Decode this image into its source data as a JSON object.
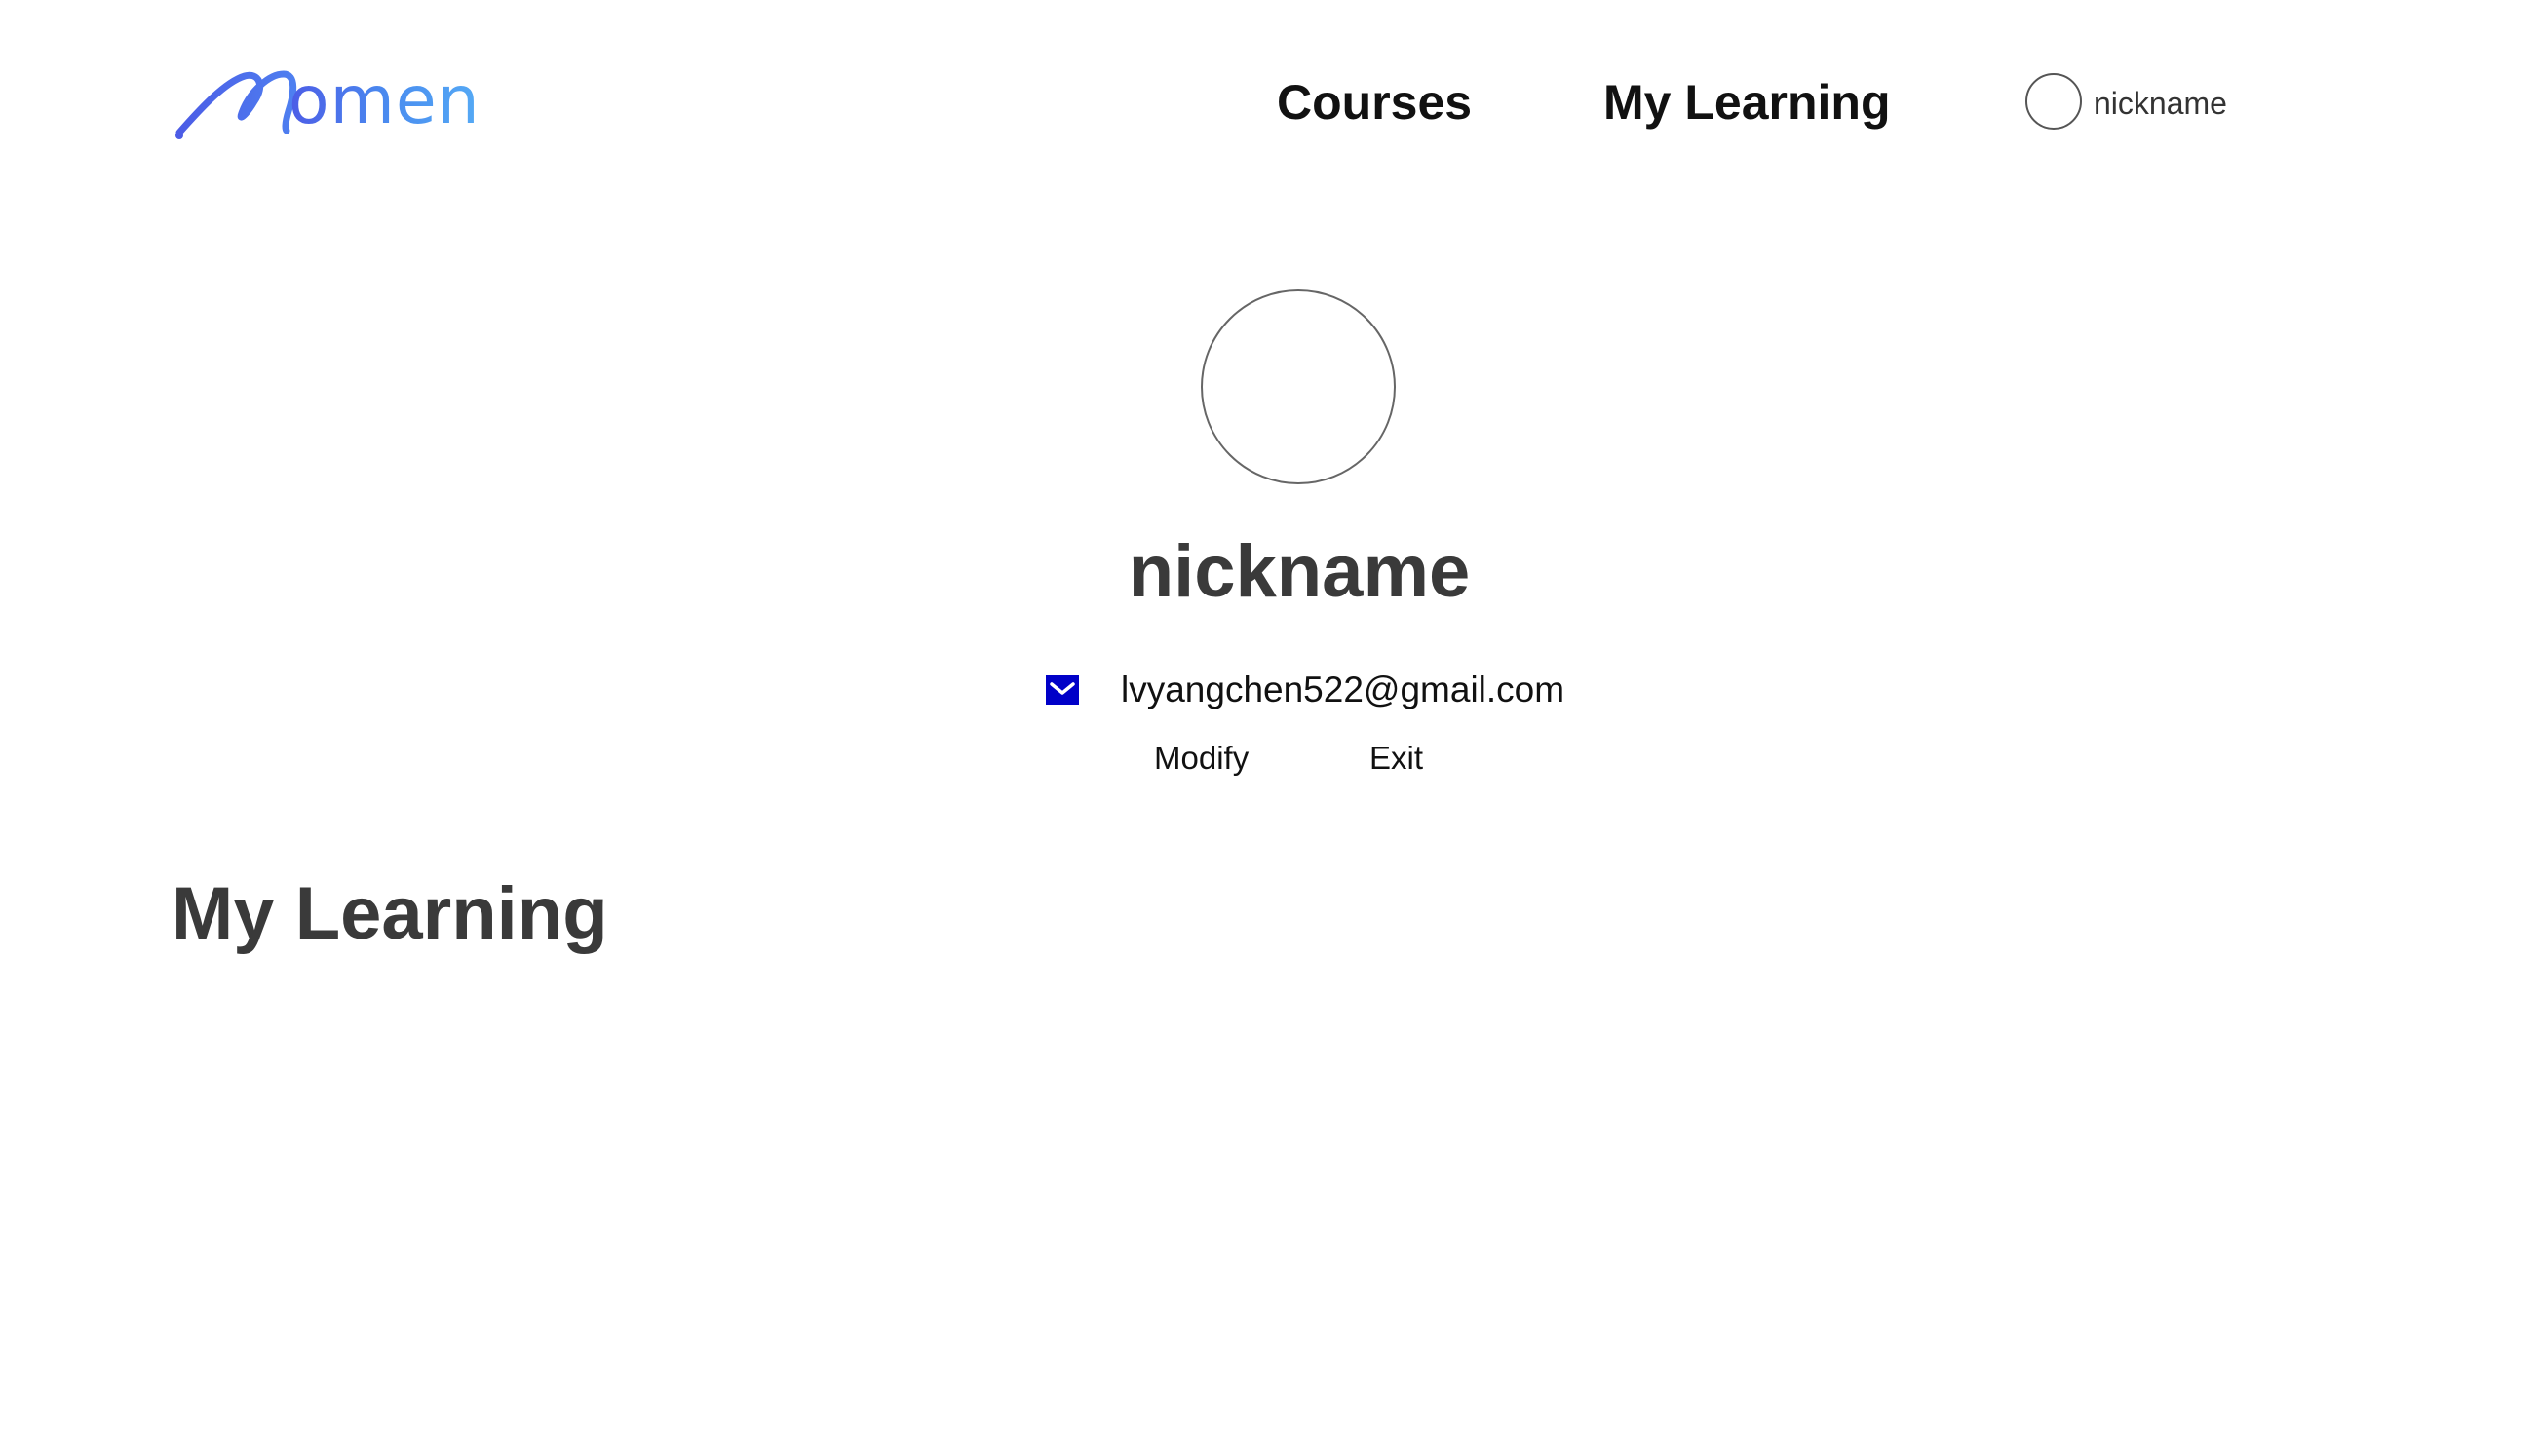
{
  "brand": {
    "name": "Momen",
    "logo_text": "omen",
    "colors": {
      "gradient_start": "#4c5ce6",
      "gradient_end": "#55aaf5"
    }
  },
  "nav": {
    "courses_label": "Courses",
    "my_learning_label": "My Learning"
  },
  "header_user": {
    "nickname": "nickname",
    "avatar_icon": "avatar-circle"
  },
  "profile": {
    "nickname": "nickname",
    "email": "lvyangchen522@gmail.com",
    "email_icon": "mail-icon",
    "email_icon_color": "#0000c8",
    "modify_label": "Modify",
    "exit_label": "Exit"
  },
  "section": {
    "title": "My Learning",
    "items": []
  }
}
